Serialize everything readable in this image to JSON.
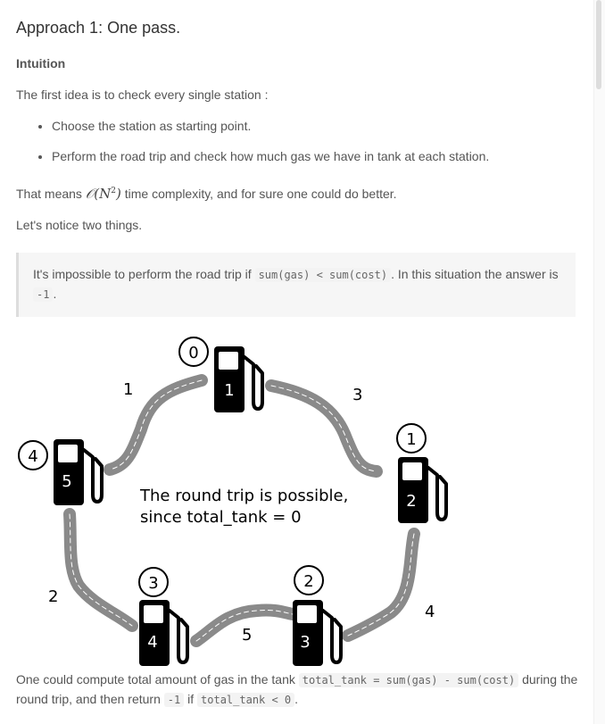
{
  "heading": "Approach 1: One pass.",
  "subheading": "Intuition",
  "intro": "The first idea is to check every single station :",
  "bullets": [
    "Choose the station as starting point.",
    "Perform the road trip and check how much gas we have in tank at each station."
  ],
  "complexity": {
    "before": "That means",
    "math_O": "𝒪(",
    "math_N": "N",
    "math_exp": "2",
    "math_close": ")",
    "after": "time complexity, and for sure one could do better."
  },
  "notice": "Let's notice two things.",
  "note": {
    "part1": "It's impossible to perform the road trip if",
    "code1": "sum(gas) < sum(cost)",
    "part2": ". In this situation the answer is",
    "code2": "-1",
    "part3": "."
  },
  "diagram": {
    "caption_line1": "The round trip is possible,",
    "caption_line2": "since total_tank = 0",
    "stations": [
      {
        "index": "0",
        "gas": "1"
      },
      {
        "index": "1",
        "gas": "2"
      },
      {
        "index": "2",
        "gas": "3"
      },
      {
        "index": "3",
        "gas": "4"
      },
      {
        "index": "4",
        "gas": "5"
      }
    ],
    "costs": [
      "3",
      "4",
      "5",
      "2",
      "1"
    ]
  },
  "bottom": {
    "part1": "One could compute total amount of gas in the tank",
    "code1": "total_tank = sum(gas) - sum(cost)",
    "part2": "during the round trip, and then return",
    "code2": "-1",
    "part3": "if",
    "code3": "total_tank < 0",
    "part4": "."
  }
}
